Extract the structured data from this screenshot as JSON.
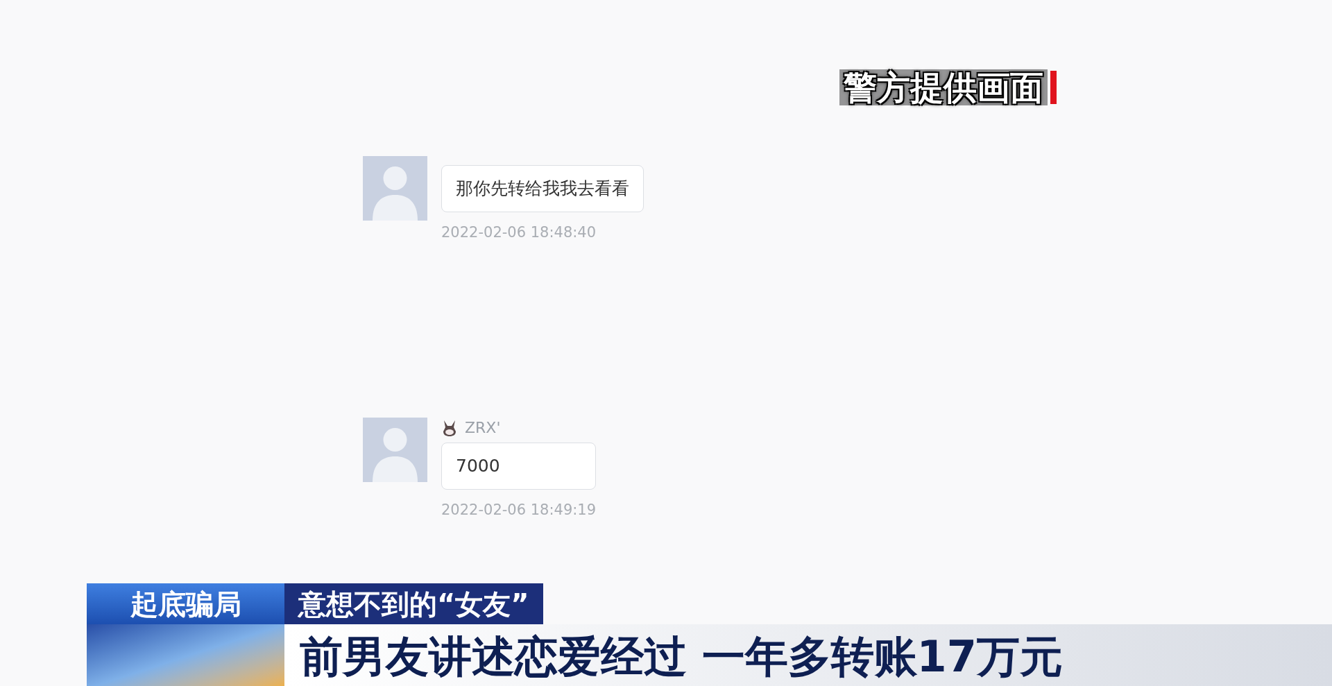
{
  "overlay_caption": "警方提供画面",
  "chat": {
    "messages": [
      {
        "text": "那你先转给我我去看看",
        "time": "2022-02-06 18:48:40"
      },
      {
        "sender": "ZRX'",
        "text": "7000",
        "time": "2022-02-06 18:49:19"
      }
    ]
  },
  "lower_third": {
    "tag": "起底骗局",
    "topic": "意想不到的“女友”",
    "headline": "前男友讲述恋爱经过 一年多转账17万元"
  }
}
